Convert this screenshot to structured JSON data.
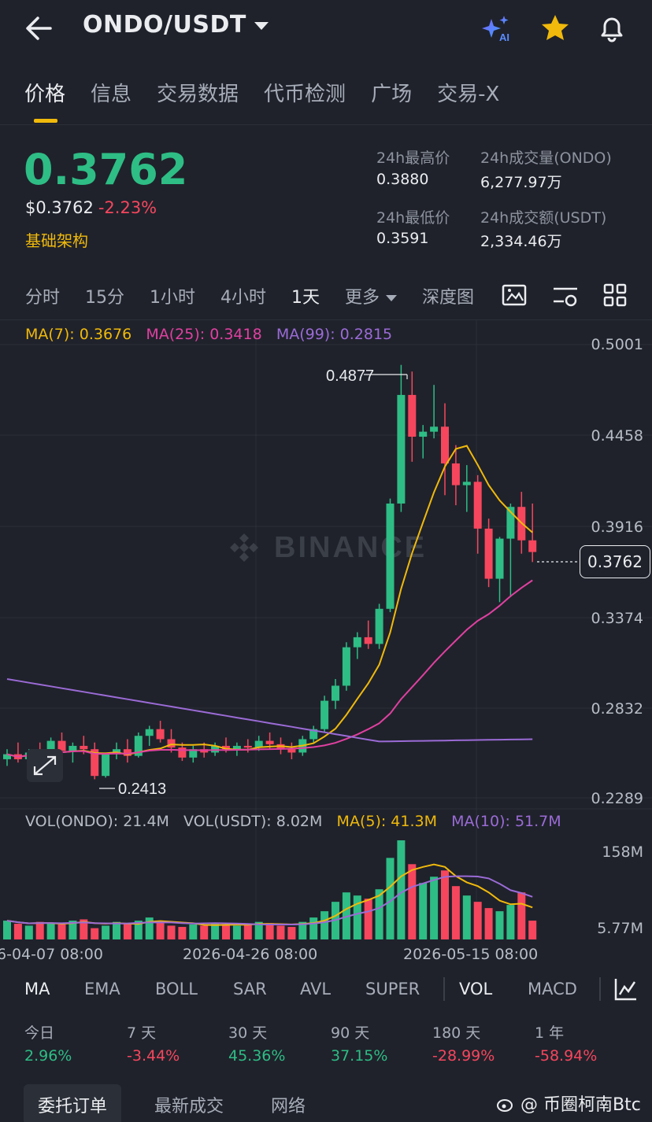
{
  "header": {
    "title": "ONDO/USDT",
    "ai_label": "AI"
  },
  "tabs": [
    "价格",
    "信息",
    "交易数据",
    "代币检测",
    "广场",
    "交易-X"
  ],
  "price": {
    "last": "0.3762",
    "usd": "$0.3762",
    "change": "-2.23%",
    "tag": "基础架构"
  },
  "stats": {
    "high_label": "24h最高价",
    "high_value": "0.3880",
    "vol_label": "24h成交量(ONDO)",
    "vol_value": "6,277.97万",
    "low_label": "24h最低价",
    "low_value": "0.3591",
    "turnover_label": "24h成交额(USDT)",
    "turnover_value": "2,334.46万"
  },
  "intervals": [
    "分时",
    "15分",
    "1小时",
    "4小时",
    "1天",
    "更多",
    "深度图"
  ],
  "ma": {
    "ma7": "MA(7): 0.3676",
    "ma25": "MA(25): 0.3418",
    "ma99": "MA(99): 0.2815"
  },
  "price_axis": [
    "0.5001",
    "0.4458",
    "0.3916",
    "0.3374",
    "0.2832",
    "0.2289"
  ],
  "current_price_tag": "0.3762",
  "high_marker": "0.4877",
  "low_marker": "0.2413",
  "watermark": "BINANCE",
  "volume": {
    "vol_ondo": "VOL(ONDO): 21.4M",
    "vol_usdt": "VOL(USDT): 8.02M",
    "ma5": "MA(5): 41.3M",
    "ma10": "MA(10): 51.7M",
    "axis_top": "158M",
    "axis_bottom": "5.77M"
  },
  "dates": [
    "6-04-07 08:00",
    "2026-04-26 08:00",
    "2026-05-15 08:00"
  ],
  "indicators": [
    "MA",
    "EMA",
    "BOLL",
    "SAR",
    "AVL",
    "SUPER",
    "VOL",
    "MACD"
  ],
  "performance": [
    {
      "label": "今日",
      "value": "2.96%"
    },
    {
      "label": "7 天",
      "value": "-3.44%"
    },
    {
      "label": "30 天",
      "value": "45.36%"
    },
    {
      "label": "90 天",
      "value": "37.15%"
    },
    {
      "label": "180 天",
      "value": "-28.99%"
    },
    {
      "label": "1 年",
      "value": "-58.94%"
    }
  ],
  "bottom_tabs": [
    "委托订单",
    "最新成交",
    "网络"
  ],
  "credit": "@ 币圈柯南Btc",
  "colors": {
    "up": "#2ebd85",
    "down": "#f6465d",
    "accent": "#f0b90b",
    "ma25": "#e040a0",
    "ma99": "#9b6bd6"
  },
  "chart_data": {
    "type": "candlestick",
    "ylim": [
      0.2289,
      0.5001
    ],
    "candles": [
      [
        0.252,
        0.258,
        0.248,
        0.255
      ],
      [
        0.255,
        0.262,
        0.25,
        0.252
      ],
      [
        0.252,
        0.258,
        0.245,
        0.256
      ],
      [
        0.256,
        0.262,
        0.25,
        0.254
      ],
      [
        0.254,
        0.265,
        0.252,
        0.263
      ],
      [
        0.263,
        0.268,
        0.255,
        0.257
      ],
      [
        0.257,
        0.262,
        0.25,
        0.26
      ],
      [
        0.26,
        0.266,
        0.255,
        0.258
      ],
      [
        0.258,
        0.262,
        0.24,
        0.242
      ],
      [
        0.242,
        0.256,
        0.241,
        0.255
      ],
      [
        0.255,
        0.262,
        0.252,
        0.258
      ],
      [
        0.258,
        0.264,
        0.25,
        0.254
      ],
      [
        0.254,
        0.268,
        0.253,
        0.266
      ],
      [
        0.266,
        0.272,
        0.26,
        0.27
      ],
      [
        0.27,
        0.275,
        0.262,
        0.264
      ],
      [
        0.264,
        0.27,
        0.256,
        0.259
      ],
      [
        0.259,
        0.262,
        0.251,
        0.253
      ],
      [
        0.253,
        0.26,
        0.25,
        0.258
      ],
      [
        0.258,
        0.262,
        0.253,
        0.256
      ],
      [
        0.256,
        0.262,
        0.254,
        0.26
      ],
      [
        0.26,
        0.265,
        0.256,
        0.258
      ],
      [
        0.258,
        0.262,
        0.254,
        0.26
      ],
      [
        0.26,
        0.264,
        0.256,
        0.259
      ],
      [
        0.259,
        0.266,
        0.257,
        0.263
      ],
      [
        0.263,
        0.268,
        0.258,
        0.261
      ],
      [
        0.261,
        0.265,
        0.255,
        0.258
      ],
      [
        0.258,
        0.262,
        0.252,
        0.256
      ],
      [
        0.256,
        0.266,
        0.254,
        0.264
      ],
      [
        0.264,
        0.272,
        0.262,
        0.27
      ],
      [
        0.27,
        0.29,
        0.268,
        0.287
      ],
      [
        0.287,
        0.3,
        0.282,
        0.296
      ],
      [
        0.296,
        0.322,
        0.293,
        0.319
      ],
      [
        0.319,
        0.328,
        0.312,
        0.325
      ],
      [
        0.325,
        0.335,
        0.318,
        0.321
      ],
      [
        0.321,
        0.345,
        0.318,
        0.342
      ],
      [
        0.342,
        0.408,
        0.34,
        0.405
      ],
      [
        0.405,
        0.488,
        0.4,
        0.47
      ],
      [
        0.47,
        0.484,
        0.43,
        0.445
      ],
      [
        0.445,
        0.452,
        0.432,
        0.448
      ],
      [
        0.448,
        0.476,
        0.444,
        0.451
      ],
      [
        0.451,
        0.465,
        0.41,
        0.429
      ],
      [
        0.429,
        0.44,
        0.404,
        0.416
      ],
      [
        0.416,
        0.428,
        0.4,
        0.418
      ],
      [
        0.418,
        0.422,
        0.375,
        0.39
      ],
      [
        0.39,
        0.396,
        0.355,
        0.36
      ],
      [
        0.36,
        0.385,
        0.346,
        0.384
      ],
      [
        0.384,
        0.405,
        0.349,
        0.403
      ],
      [
        0.403,
        0.412,
        0.375,
        0.383
      ],
      [
        0.383,
        0.405,
        0.37,
        0.376
      ]
    ],
    "volumes": [
      30,
      25,
      22,
      28,
      26,
      24,
      30,
      32,
      18,
      22,
      28,
      26,
      30,
      35,
      28,
      22,
      20,
      24,
      22,
      26,
      24,
      22,
      24,
      28,
      26,
      22,
      20,
      28,
      35,
      45,
      60,
      75,
      70,
      65,
      80,
      130,
      158,
      120,
      90,
      100,
      110,
      85,
      70,
      60,
      50,
      45,
      55,
      75,
      30
    ]
  }
}
